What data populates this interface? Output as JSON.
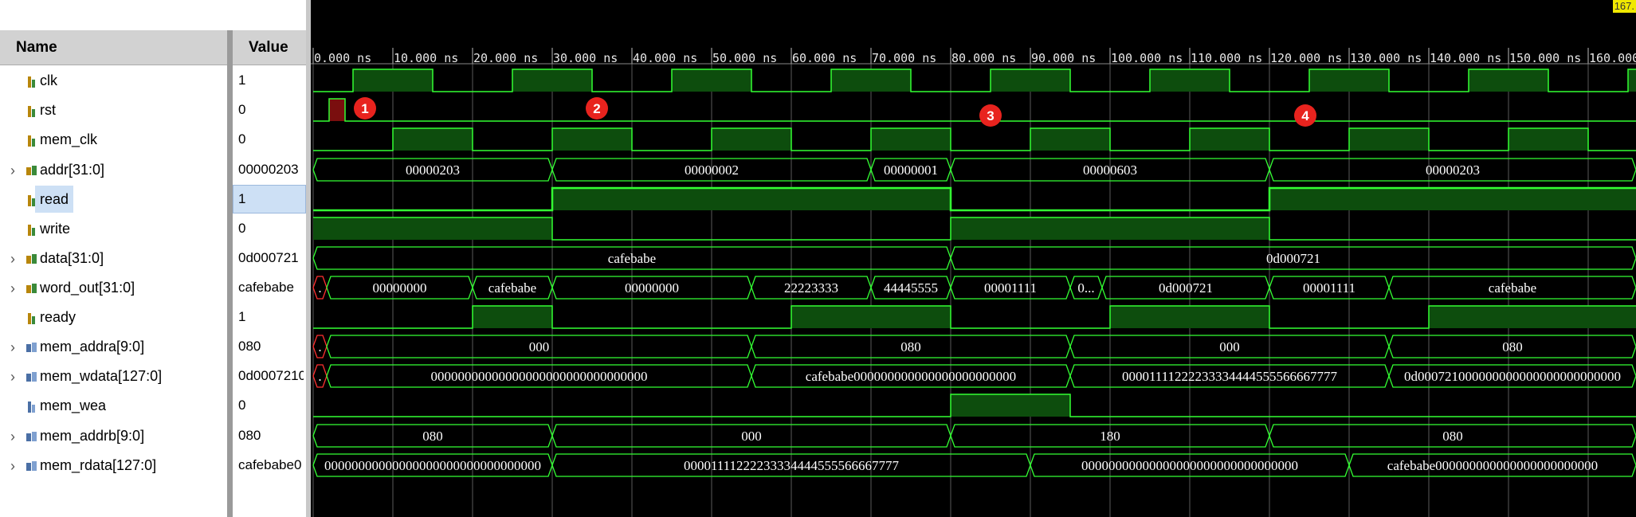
{
  "header": {
    "name_label": "Name",
    "value_label": "Value"
  },
  "cursor_time": "167.",
  "timeline": {
    "tick_labels": [
      "0.000 ns",
      "10.000 ns",
      "20.000 ns",
      "30.000 ns",
      "40.000 ns",
      "50.000 ns",
      "60.000 ns",
      "70.000 ns",
      "80.000 ns",
      "90.000 ns",
      "100.000 ns",
      "110.000 ns",
      "120.000 ns",
      "130.000 ns",
      "140.000 ns",
      "150.000 ns",
      "160.000"
    ]
  },
  "markers": [
    "1",
    "2",
    "3",
    "4"
  ],
  "colors": {
    "wave": "#33ff33",
    "fill": "#0d4d0d",
    "grid": "#5a5a5a",
    "error": "#ff3030",
    "marker": "#e8231e"
  },
  "signals": [
    {
      "name": "clk",
      "value": "1",
      "type": "bit",
      "icon": "bit-signal-icon"
    },
    {
      "name": "rst",
      "value": "0",
      "type": "bit",
      "icon": "bit-signal-icon"
    },
    {
      "name": "mem_clk",
      "value": "0",
      "type": "bit",
      "icon": "bit-signal-icon"
    },
    {
      "name": "addr[31:0]",
      "value": "00000203",
      "type": "bus",
      "icon": "bus-signal-icon",
      "segments": [
        {
          "label": "00000203"
        },
        {
          "label": "00000002"
        },
        {
          "label": "00000001"
        },
        {
          "label": "00000603"
        },
        {
          "label": "00000203"
        }
      ]
    },
    {
      "name": "read",
      "value": "1",
      "type": "bit",
      "icon": "bit-signal-icon",
      "selected": true
    },
    {
      "name": "write",
      "value": "0",
      "type": "bit",
      "icon": "bit-signal-icon"
    },
    {
      "name": "data[31:0]",
      "value": "0d000721",
      "type": "bus",
      "icon": "bus-signal-icon",
      "segments": [
        {
          "label": "cafebabe"
        },
        {
          "label": "0d000721"
        }
      ]
    },
    {
      "name": "word_out[31:0]",
      "value": "cafebabe",
      "type": "bus",
      "icon": "bus-signal-icon",
      "segments": [
        {
          "label": "."
        },
        {
          "label": "00000000"
        },
        {
          "label": "cafebabe"
        },
        {
          "label": "00000000"
        },
        {
          "label": "22223333"
        },
        {
          "label": "44445555"
        },
        {
          "label": "00001111"
        },
        {
          "label": "0..."
        },
        {
          "label": "0d000721"
        },
        {
          "label": "00001111"
        },
        {
          "label": "cafebabe"
        }
      ]
    },
    {
      "name": "ready",
      "value": "1",
      "type": "bit",
      "icon": "bit-signal-icon"
    },
    {
      "name": "mem_addra[9:0]",
      "value": "080",
      "type": "bus",
      "icon": "mem-bus-icon",
      "segments": [
        {
          "label": "."
        },
        {
          "label": "000"
        },
        {
          "label": "080"
        },
        {
          "label": "000"
        },
        {
          "label": "080"
        }
      ]
    },
    {
      "name": "mem_wdata[127:0]",
      "value": "0d0007210",
      "type": "bus",
      "icon": "mem-bus-icon",
      "segments": [
        {
          "label": "."
        },
        {
          "label": "00000000000000000000000000000000"
        },
        {
          "label": "cafebabe000000000000000000000000"
        },
        {
          "label": "00001111222233334444555566667777"
        },
        {
          "label": "0d000721000000000000000000000000"
        }
      ]
    },
    {
      "name": "mem_wea",
      "value": "0",
      "type": "bit",
      "icon": "mem-bit-icon"
    },
    {
      "name": "mem_addrb[9:0]",
      "value": "080",
      "type": "bus",
      "icon": "mem-bus-icon",
      "segments": [
        {
          "label": "080"
        },
        {
          "label": "000"
        },
        {
          "label": "180"
        },
        {
          "label": "080"
        }
      ]
    },
    {
      "name": "mem_rdata[127:0]",
      "value": "cafebabe0",
      "type": "bus",
      "icon": "mem-bus-icon",
      "segments": [
        {
          "label": "00000000000000000000000000000000"
        },
        {
          "label": "00001111222233334444555566667777"
        },
        {
          "label": "00000000000000000000000000000000"
        },
        {
          "label": "cafebabe000000000000000000000000"
        }
      ]
    }
  ]
}
